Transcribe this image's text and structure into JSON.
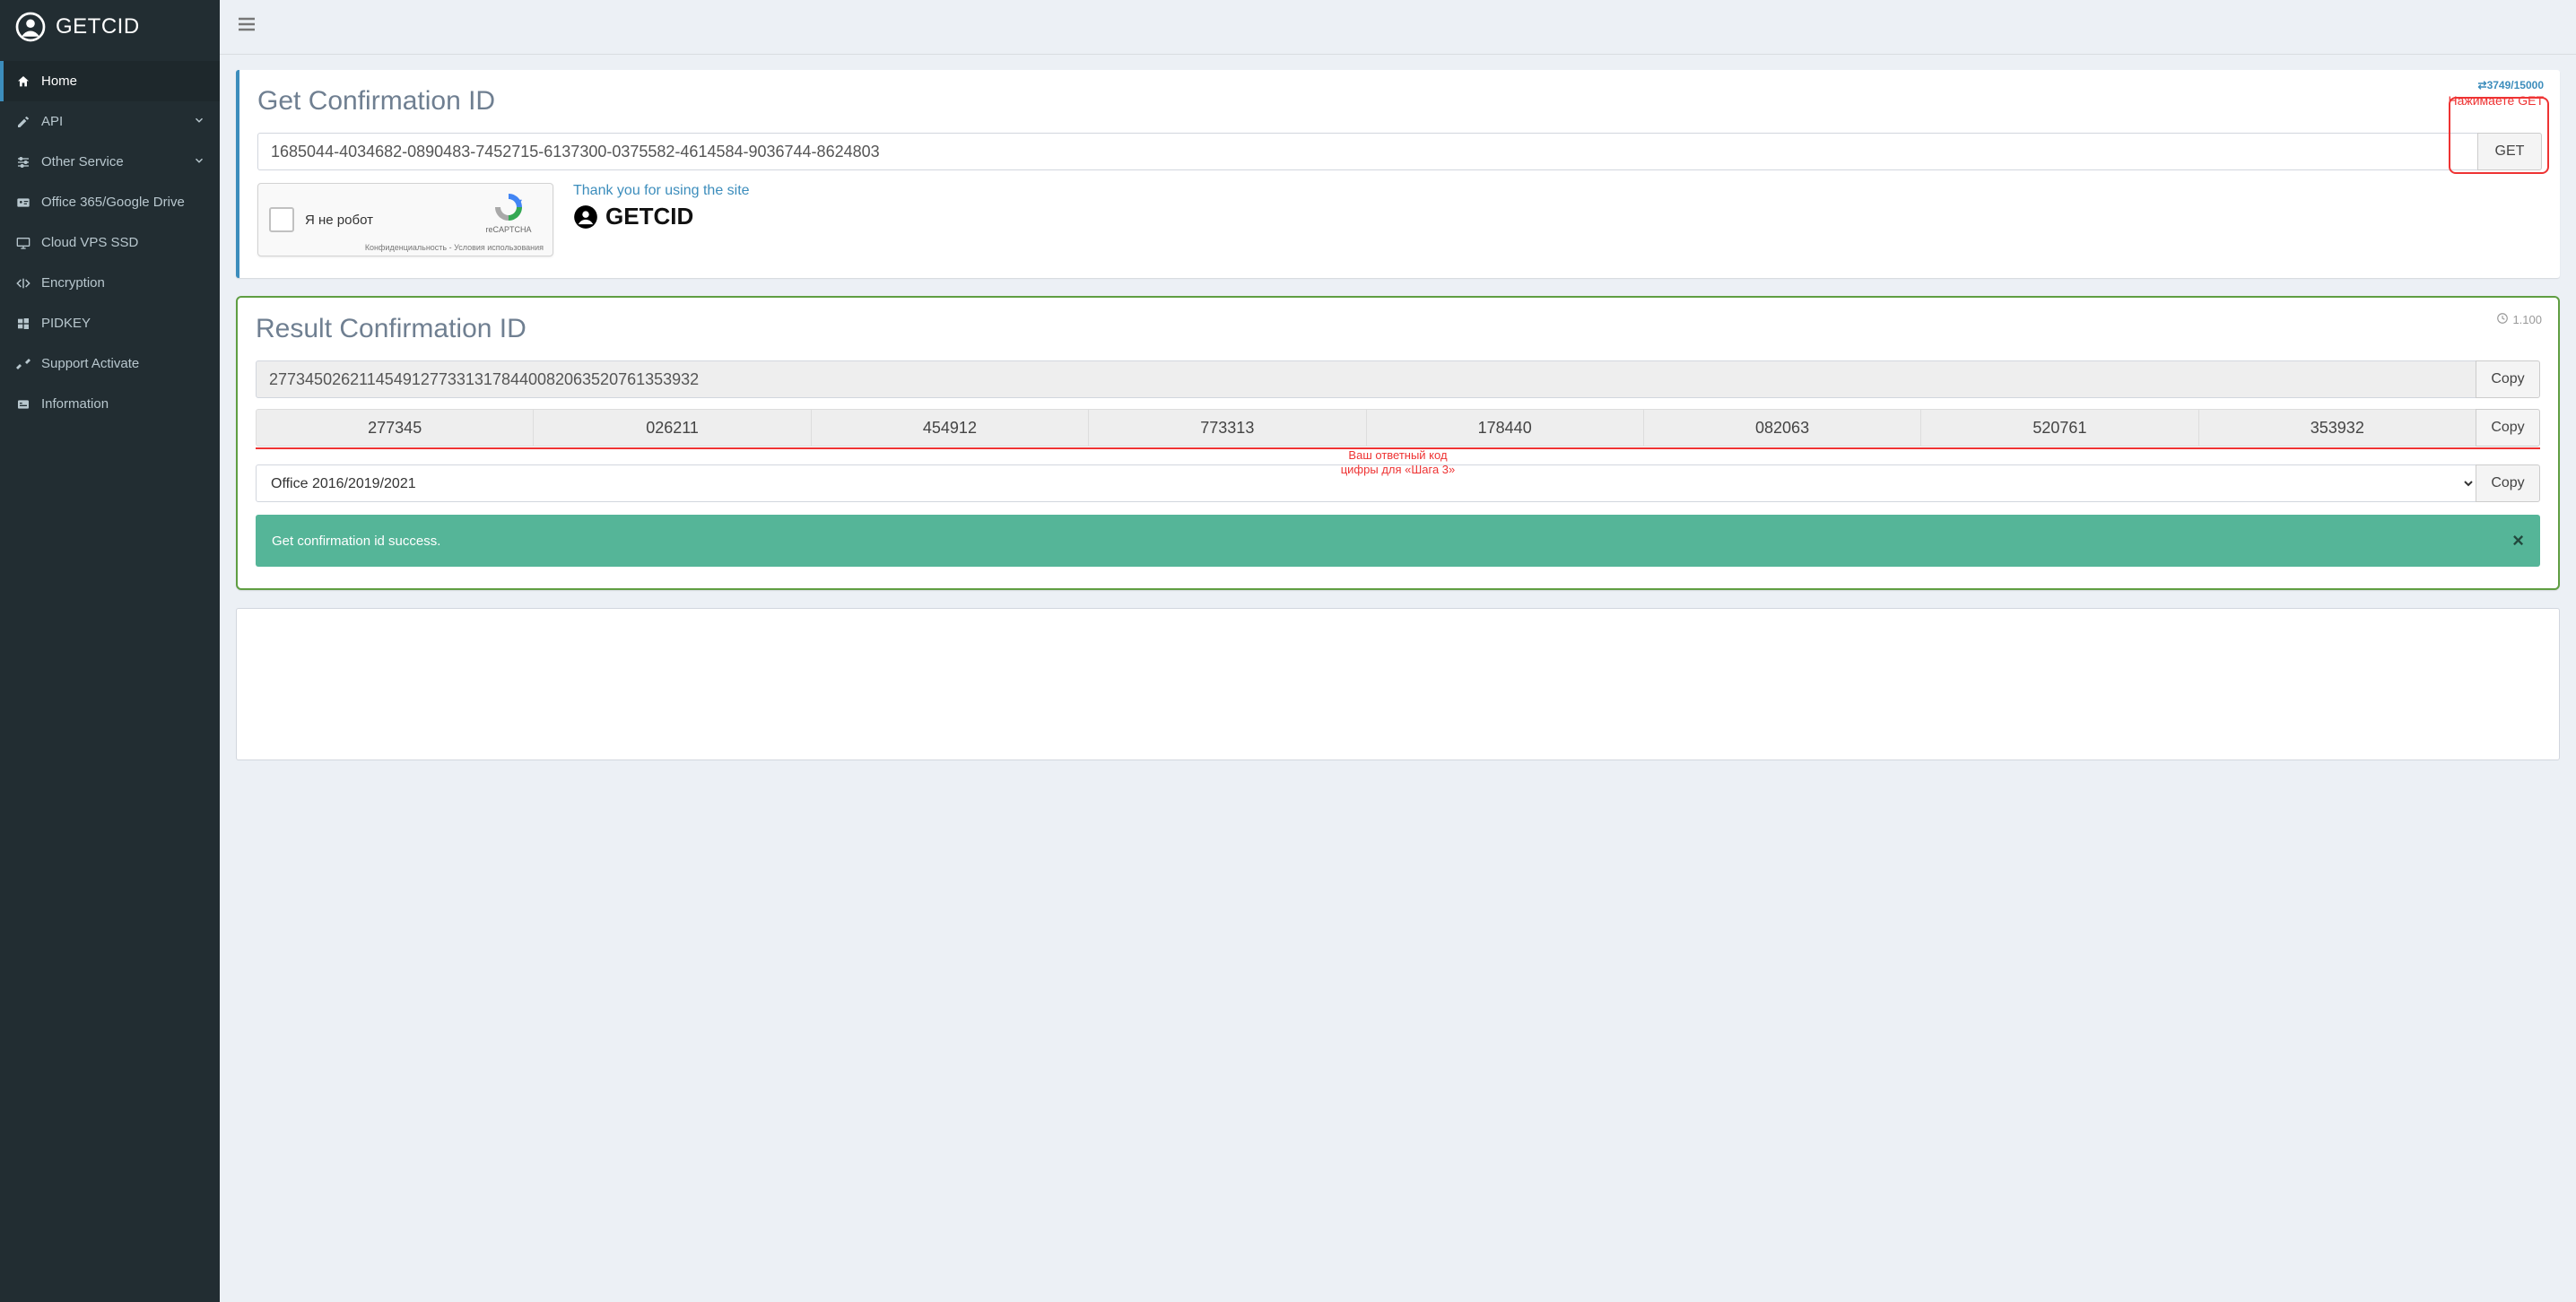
{
  "brand": "GETCID",
  "sidebar": {
    "items": [
      {
        "icon": "home",
        "label": "Home",
        "active": true,
        "chevron": false
      },
      {
        "icon": "edit",
        "label": "API",
        "active": false,
        "chevron": true
      },
      {
        "icon": "sliders",
        "label": "Other Service",
        "active": false,
        "chevron": true
      },
      {
        "icon": "id-card",
        "label": "Office 365/Google Drive",
        "active": false,
        "chevron": false
      },
      {
        "icon": "monitor",
        "label": "Cloud VPS SSD",
        "active": false,
        "chevron": false
      },
      {
        "icon": "code",
        "label": "Encryption",
        "active": false,
        "chevron": false
      },
      {
        "icon": "windows",
        "label": "PIDKEY",
        "active": false,
        "chevron": false
      },
      {
        "icon": "tools",
        "label": "Support Activate",
        "active": false,
        "chevron": false
      },
      {
        "icon": "info",
        "label": "Information",
        "active": false,
        "chevron": false
      }
    ]
  },
  "input_panel": {
    "title": "Get Confirmation ID",
    "counter": {
      "used": "3749",
      "total": "15000"
    },
    "press_get": "Нажимаете GET",
    "input_value": "1685044-4034682-0890483-7452715-6137300-0375582-4614584-9036744-8624803",
    "get_label": "GET",
    "recaptcha": {
      "text": "Я не робот",
      "brand": "reCAPTCHA",
      "footer": "Конфиденциальность - Условия использования"
    },
    "thanks": "Thank you for using the site",
    "brand_inline": "GETCID"
  },
  "result_panel": {
    "title": "Result Confirmation ID",
    "timer": "1.100",
    "full_value": "277345026211454912773313178440082063520761353932",
    "segments": [
      "277345",
      "026211",
      "454912",
      "773313",
      "178440",
      "082063",
      "520761",
      "353932"
    ],
    "copy_label": "Copy",
    "red_caption_l1": "Ваш ответный код",
    "red_caption_l2": "цифры для «Шага 3»",
    "select_value": "Office 2016/2019/2021",
    "alert_text": "Get confirmation id success."
  }
}
